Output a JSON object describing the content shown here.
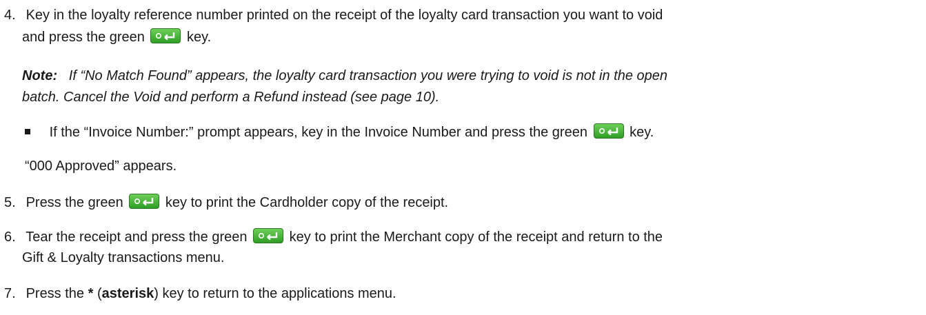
{
  "step4": {
    "number": "4.",
    "line1": "Key in the loyalty reference number printed on the receipt of the loyalty card transaction you want to void",
    "line2_pre": "and press the green",
    "line2_post": "key."
  },
  "note": {
    "label": "Note:",
    "line1": "If “No Match Found” appears, the loyalty card transaction you were trying to void is not in the open",
    "line2": "batch. Cancel the Void and perform a Refund instead (see page 10)."
  },
  "bullet": {
    "pre": "If the “Invoice Number:” prompt appears, key in the Invoice Number and press the green",
    "post": "key."
  },
  "approved": "“000 Approved” appears.",
  "step5": {
    "number": "5.",
    "pre": "Press the green",
    "post": "key to print the Cardholder copy of the receipt."
  },
  "step6": {
    "number": "6.",
    "pre": "Tear the receipt and press the green",
    "post": "key to print the Merchant copy of the receipt and return to the",
    "line2": "Gift & Loyalty transactions menu."
  },
  "step7": {
    "number": "7.",
    "pre": "Press the",
    "star": "*",
    "open": "(",
    "word": "asterisk",
    "close": ")",
    "post": "key to return to the applications menu."
  },
  "icons": {
    "green_key": "enter-key-icon"
  }
}
